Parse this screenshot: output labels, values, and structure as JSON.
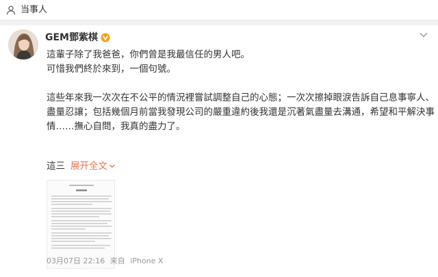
{
  "header": {
    "title": "当事人"
  },
  "post": {
    "username": "GEM鄧紫棋",
    "lines": [
      "這輩子除了我爸爸，你們曾是我最信任的男人吧。",
      "可惜我們終於來到，一個句號。",
      "",
      "這些年來我一次次在不公平的情況裡嘗試調整自己的心態；一次次擦掉眼淚告訴自己息事寧人、",
      "盡量忍讓；包括幾個月前當我發現公司的嚴重違約後我還是沉著氣盡量去溝通，希望和平解決事",
      "情……撫心自問，我真的盡力了。"
    ],
    "tail_text": "這三",
    "expand_label": "展开全文",
    "timestamp": "03月07日 22:16",
    "source_prefix": "来自",
    "source": "iPhone X"
  },
  "colors": {
    "link": "#eb7350",
    "meta": "#999999",
    "badge": "#f6a21b"
  },
  "icons": {
    "header": "person-icon",
    "badge": "verified-v-icon",
    "menu": "chevron-down-icon"
  }
}
